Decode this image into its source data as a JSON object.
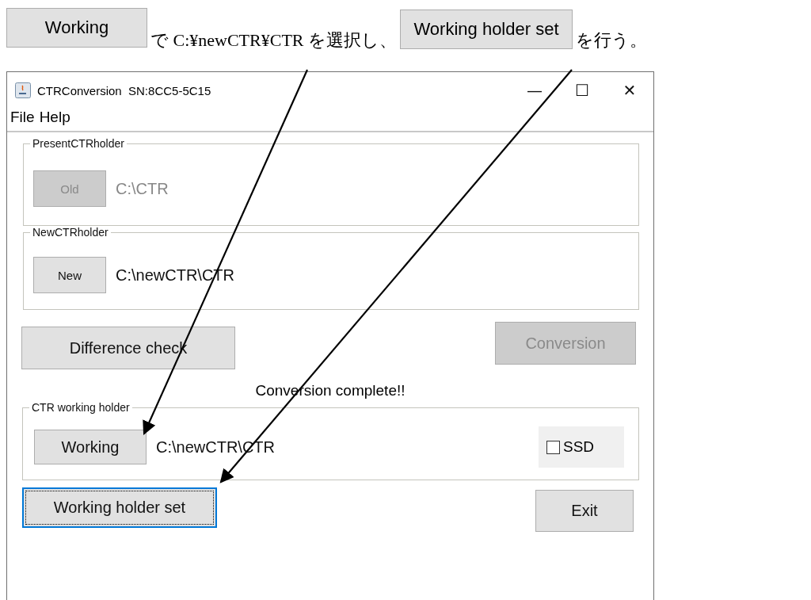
{
  "instruction": {
    "parts": [
      {
        "kind": "button",
        "text": "Working"
      },
      {
        "kind": "text",
        "text": "で C:¥newCTR¥CTR を選択し、"
      },
      {
        "kind": "button",
        "text": "Working holder set"
      },
      {
        "kind": "text",
        "text": "を行う。"
      }
    ]
  },
  "window": {
    "title": "CTRConversion  SN:8CC5-5C15",
    "controls": [
      "—",
      "☐",
      "✕"
    ]
  },
  "menu": [
    {
      "label": "File"
    },
    {
      "label": "Help"
    }
  ],
  "holders": [
    {
      "legend": "PresentCTRholder",
      "button": "Old",
      "path": "C:\\CTR",
      "disabled": true
    },
    {
      "legend": "NewCTRholder",
      "button": "New",
      "path": "C:\\newCTR\\CTR",
      "disabled": false
    }
  ],
  "actions": [
    {
      "label": "Difference check",
      "disabled": false
    },
    {
      "label": "Conversion",
      "disabled": true
    }
  ],
  "status": "Conversion complete!!",
  "working": {
    "legend": "CTR working holder",
    "button": "Working",
    "path": "C:\\newCTR\\CTR",
    "checkbox": {
      "label": "SSD",
      "checked": false
    }
  },
  "bottom_buttons": [
    {
      "label": "Working holder set",
      "focused": true
    },
    {
      "label": "Exit",
      "focused": false
    }
  ]
}
